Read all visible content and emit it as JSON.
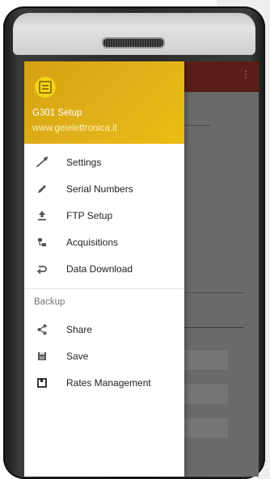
{
  "app": {
    "name": "G301 Setup",
    "website": "www.geielettronica.it"
  },
  "menu": {
    "items": [
      {
        "label": "Settings",
        "icon": "wrench-icon"
      },
      {
        "label": "Serial Numbers",
        "icon": "pencil-icon"
      },
      {
        "label": "FTP Setup",
        "icon": "upload-icon"
      },
      {
        "label": "Acquisitions",
        "icon": "acquisitions-icon"
      },
      {
        "label": "Data Download",
        "icon": "return-icon"
      }
    ],
    "section_label": "Backup",
    "backup_items": [
      {
        "label": "Share",
        "icon": "share-icon"
      },
      {
        "label": "Save",
        "icon": "save-icon"
      },
      {
        "label": "Rates Management",
        "icon": "rates-icon"
      }
    ]
  },
  "toolbar": {
    "overflow_icon": "⋮"
  },
  "colors": {
    "header_accent": "#e0b21a",
    "toolbar_dimmed": "#5a1e18",
    "icon": "#555555"
  }
}
